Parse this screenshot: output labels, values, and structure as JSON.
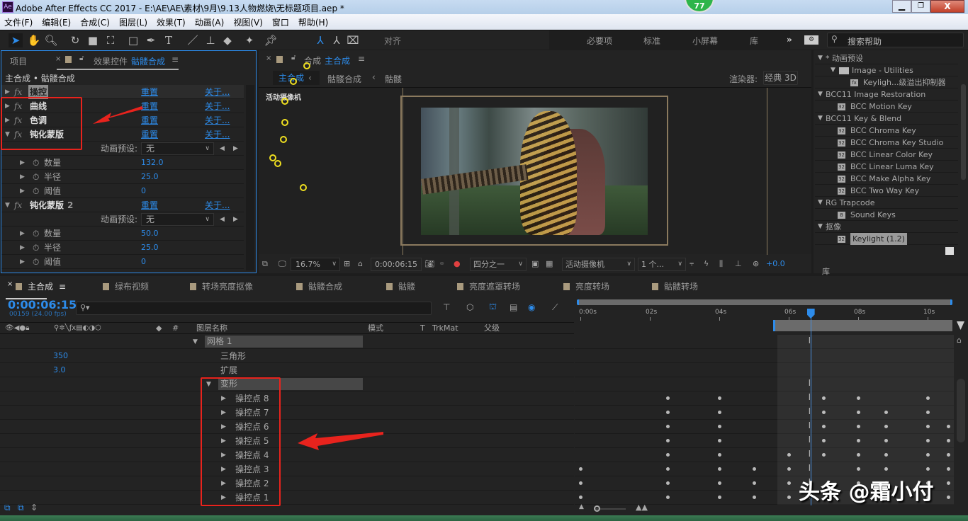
{
  "window": {
    "title": "Adobe After Effects CC 2017 - E:\\AE\\AE\\素材\\9月\\9.13人物燃烧\\无标题项目.aep *",
    "app_icon": "Ae",
    "badge": "77"
  },
  "menu": [
    "文件(F)",
    "编辑(E)",
    "合成(C)",
    "图层(L)",
    "效果(T)",
    "动画(A)",
    "视图(V)",
    "窗口",
    "帮助(H)"
  ],
  "toolbar": {
    "snap_label": "对齐",
    "workspaces": [
      "必要项",
      "标准",
      "小屏幕",
      "库"
    ],
    "more": "»",
    "search_placeholder": "搜索帮助"
  },
  "effects_panel": {
    "tabs": {
      "project": "项目",
      "effect_controls": "效果控件",
      "effect_target": "骷髅合成"
    },
    "breadcrumb": "主合成 • 骷髅合成",
    "reset": "重置",
    "about": "关于...",
    "effects": [
      {
        "name": "操控",
        "expanded": false
      },
      {
        "name": "曲线",
        "expanded": false
      },
      {
        "name": "色调",
        "expanded": false
      },
      {
        "name": "钝化蒙版",
        "expanded": true,
        "preset_label": "动画预设:",
        "preset_value": "无",
        "params": [
          {
            "name": "数量",
            "value": "132.0"
          },
          {
            "name": "半径",
            "value": "25.0"
          },
          {
            "name": "阈值",
            "value": "0"
          }
        ]
      },
      {
        "name": "钝化蒙版",
        "suffix": "2",
        "expanded": true,
        "preset_label": "动画预设:",
        "preset_value": "无",
        "params": [
          {
            "name": "数量",
            "value": "50.0"
          },
          {
            "name": "半径",
            "value": "25.0"
          },
          {
            "name": "阈值",
            "value": "0"
          }
        ]
      }
    ]
  },
  "comp_panel": {
    "tab_prefix": "合成",
    "tab_name": "主合成",
    "breadcrumbs": [
      "主合成",
      "骷髅合成",
      "骷髅"
    ],
    "renderer_label": "渲染器:",
    "renderer_value": "经典 3D",
    "camera_label": "活动摄像机",
    "footer": {
      "zoom": "16.7%",
      "timecode": "0:00:06:15",
      "resolution": "四分之一",
      "camera": "活动摄像机",
      "views": "1 个...",
      "exposure": "+0.0"
    }
  },
  "presets_panel": {
    "items": [
      {
        "label": "* 动画预设",
        "level": 0,
        "type": "group"
      },
      {
        "label": "Image - Utilities",
        "level": 1,
        "type": "folder"
      },
      {
        "label": "Keyligh...级溢出抑制器",
        "level": 2,
        "type": "preset"
      },
      {
        "label": "BCC11 Image Restoration",
        "level": 0,
        "type": "group"
      },
      {
        "label": "BCC Motion Key",
        "level": 1,
        "type": "effect",
        "bit": "32"
      },
      {
        "label": "BCC11 Key & Blend",
        "level": 0,
        "type": "group"
      },
      {
        "label": "BCC Chroma Key",
        "level": 1,
        "type": "effect",
        "bit": "32"
      },
      {
        "label": "BCC Chroma Key Studio",
        "level": 1,
        "type": "effect",
        "bit": "32"
      },
      {
        "label": "BCC Linear Color Key",
        "level": 1,
        "type": "effect",
        "bit": "32"
      },
      {
        "label": "BCC Linear Luma Key",
        "level": 1,
        "type": "effect",
        "bit": "32"
      },
      {
        "label": "BCC Make Alpha Key",
        "level": 1,
        "type": "effect",
        "bit": "32"
      },
      {
        "label": "BCC Two Way Key",
        "level": 1,
        "type": "effect",
        "bit": "32"
      },
      {
        "label": "RG Trapcode",
        "level": 0,
        "type": "group"
      },
      {
        "label": "Sound Keys",
        "level": 1,
        "type": "effect",
        "bit": "8"
      },
      {
        "label": "抠像",
        "level": 0,
        "type": "group"
      },
      {
        "label": "Keylight (1.2)",
        "level": 1,
        "type": "effect",
        "bit": "32",
        "selected": true
      }
    ],
    "library_tab": "库"
  },
  "timeline": {
    "tabs": [
      "主合成",
      "绿布视频",
      "转场亮度抠像",
      "骷髅合成",
      "骷髅",
      "亮度遮罩转场",
      "亮度转场",
      "骷髅转场"
    ],
    "active_tab": "主合成",
    "timecode": "0:00:06:15",
    "frame_info": "00159 (24.00 fps)",
    "columns": {
      "hash": "#",
      "layer_name": "图层名称",
      "mode": "模式",
      "t": "T",
      "trkmat": "TrkMat",
      "parent": "父级"
    },
    "ruler": [
      "0:00s",
      "02s",
      "04s",
      "06s",
      "08s",
      "10s"
    ],
    "playhead_seconds": 6.625,
    "rows": [
      {
        "name": "网格 1",
        "value": "",
        "kind": "group"
      },
      {
        "name": "三角形",
        "value": "350",
        "kind": "prop"
      },
      {
        "name": "扩展",
        "value": "3.0",
        "kind": "prop"
      },
      {
        "name": "变形",
        "value": "",
        "kind": "group"
      },
      {
        "name": "操控点 8",
        "keyframes": [
          2.5,
          4,
          7,
          8,
          10
        ]
      },
      {
        "name": "操控点 7",
        "keyframes": [
          2.5,
          4,
          7,
          8,
          8.8,
          10
        ]
      },
      {
        "name": "操控点 6",
        "keyframes": [
          2.5,
          4,
          7,
          8,
          8.8,
          10,
          10.6
        ]
      },
      {
        "name": "操控点 5",
        "keyframes": [
          2.5,
          4,
          7,
          8,
          8.8,
          10,
          10.6
        ]
      },
      {
        "name": "操控点 4",
        "keyframes": [
          2.5,
          4,
          6,
          7,
          8,
          8.8,
          10,
          10.6
        ]
      },
      {
        "name": "操控点 3",
        "keyframes": [
          0,
          2.5,
          4,
          5,
          6,
          8,
          8.8,
          10,
          10.6
        ]
      },
      {
        "name": "操控点 2",
        "keyframes": [
          0,
          2.5,
          4,
          5,
          6,
          8,
          8.8,
          10,
          10.6
        ]
      },
      {
        "name": "操控点 1",
        "keyframes": [
          0,
          2.5,
          4,
          5,
          6,
          8,
          8.8,
          10,
          10.6
        ]
      }
    ]
  },
  "watermark": "头条 @霜小付",
  "colors": {
    "accent": "#2d8ceb",
    "annotation": "#e8231d",
    "pin": "#f0e020"
  }
}
